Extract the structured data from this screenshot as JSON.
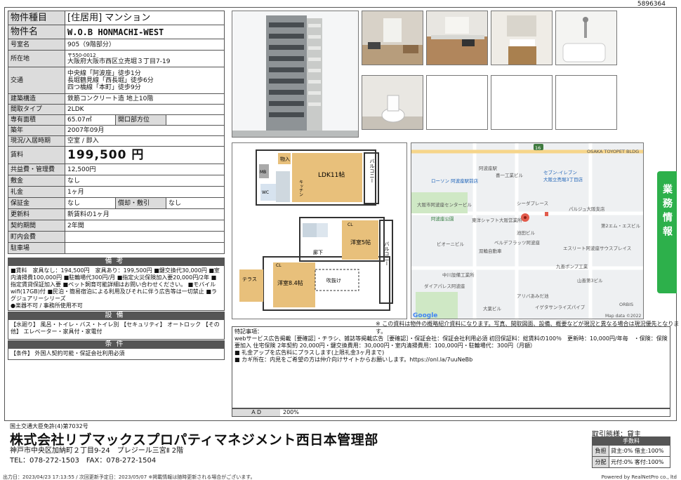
{
  "doc_id": "5896364",
  "property": {
    "rows": [
      {
        "label": "物件種目",
        "value": "[住居用] マンション"
      },
      {
        "label": "物件名",
        "value": "W.O.B HONMACHI-WEST"
      },
      {
        "label": "号室名",
        "value": "905（9階部分）"
      },
      {
        "label": "所在地",
        "postal": "〒550-0012",
        "value": "大阪府大阪市西区立売堀３丁目7-19"
      },
      {
        "label": "交通",
        "lines": [
          "中央線「阿波座」徒歩1分",
          "長堀鶴見線「西長堀」徒歩6分",
          "四つ橋線「本町」徒歩9分"
        ]
      },
      {
        "label": "建築構造",
        "value": "鉄筋コンクリート造 地上10階"
      },
      {
        "label": "間取タイプ",
        "value": "2LDK"
      },
      {
        "label": "専有面積",
        "value": "65.07㎡",
        "label2": "開口部方位",
        "value2": ""
      },
      {
        "label": "築年",
        "value": "2007年09月"
      },
      {
        "label": "現況/入居時期",
        "value": "空室 / 即入"
      },
      {
        "label": "賃料",
        "value": "199,500 円"
      },
      {
        "label": "共益費・管理費",
        "value": "12,500円"
      },
      {
        "label": "敷金",
        "value": "なし"
      },
      {
        "label": "礼金",
        "value": "1ヶ月"
      },
      {
        "label": "保証金",
        "value": "なし",
        "label2": "償却・敷引",
        "value2": "なし"
      },
      {
        "label": "更新料",
        "value": "新賃料の1ヶ月"
      },
      {
        "label": "契約期間",
        "value": "2年間"
      },
      {
        "label": "町内会費",
        "value": ""
      },
      {
        "label": "駐車場",
        "value": ""
      }
    ]
  },
  "remarks": {
    "title": "備考",
    "text": "■賃料　家具なし：194,500円　家具あり：199,500円 ■鍵交換代30,000円 ■室内清掃費100,000円 ■駐輪場代300円/月 ■指定火災保険加入要20,000円/2年 ■指定賃貸保証加入要 ■ペット飼育可能詳細はお問い合わせください。 ■モバイルwifi(17GB)付 ■民泊・簡易宿泊による利用及びそれに伴う広告等は一切禁止 ■ラグジュアリーシリーズ",
    "text2": "●楽器不可 / 事務所使用不可"
  },
  "equipment": {
    "title": "設備",
    "text": "【水廻り】 風呂・トイレ・バス・トイレ別 【セキュリティ】 オートロック 【その他】 エレベーター・家具付・家電付"
  },
  "conditions": {
    "title": "条件",
    "text": "【条件】 外国人契約可能・保証会社利用必須"
  },
  "floorplan": {
    "labels": {
      "ldk": "LDK11帖",
      "bal1": "バルコニー",
      "bal2": "バルコニー",
      "western1": "洋室5帖",
      "western2": "洋室8.4帖",
      "terrace": "テラス",
      "hall": "廊下",
      "void": "吹抜け",
      "storage": "物入",
      "cl1": "CL",
      "cl2": "CL",
      "mb": "MB",
      "wc": "WC",
      "kitchen": "キッチン"
    }
  },
  "map": {
    "labels": [
      "阿波座駅",
      "喜一工業ビル",
      "ローソン 阿波座駅前店",
      "セブン-イレブン",
      "大阪立売堀3丁目店",
      "OSAKA TOYOPET BLDG",
      "大阪市阿波座センタービル",
      "シーダプレース",
      "パルジュ大阪支店",
      "阿波座公園",
      "東洋シャフト大阪営業所",
      "池田ビル",
      "第2エム・エスビル",
      "ベルデフラッツ阿波座",
      "ビオーニビル",
      "双輪自動車",
      "エスリート阿波座サウスプレイス",
      "中川設備工業所",
      "九善ポンプ工業",
      "山善第3ビル",
      "ダイアパレス阿波座",
      "アリバあみだ池",
      "イゲタサンライズパイプ",
      "大薬ビル",
      "ORBIS",
      "Google",
      "Map data ©2022"
    ],
    "route_number": "16"
  },
  "image_note": "※ この資料は物件の概略紹介資料になります。写真、間取図面、設備、概要などが現況と異なる場合は現況優先となります。",
  "notes": {
    "title": "特記事項：",
    "lines": [
      "webサービス広告掲載［要確認］・チラシ、雑誌等掲載広告［要確認］・保証会社：保証会社利用必須 初回保証料：総賃料の100％　更新時：10,000円/年毎　・保険：保険要加入 住宅保険 2年契約 20,000円・鍵交換費用：30,000円・室内清掃費用：100,000円・駐輪場代：300円（月額）",
      "■ 礼金アップを広告料にプラスします(上限礼金3ヶ月まで)",
      "■ カギ所在：内見をご希望の方は仲介向けサイトからお願いします。https://onl.la/7uuNeBb"
    ]
  },
  "ad": {
    "label": "ＡＤ",
    "value": "200%"
  },
  "side_tab": "業務情報",
  "company": {
    "license": "国土交通大臣免許(4)第7032号",
    "name": "株式会社リブマックスプロパティマネジメント西日本管理部",
    "address": "神戸市中央区加納町２丁目9-24　プレジール三宮Ⅱ 2階",
    "tel": "TEL：078-272-1503　FAX：078-272-1504"
  },
  "deal": {
    "label": "取引態様：貸主",
    "fee_title": "手数料",
    "rows": [
      {
        "label": "負担",
        "value": "貸主:0% 借主:100%"
      },
      {
        "label": "分配",
        "value": "元付:0% 客付:100%"
      }
    ]
  },
  "footer": {
    "left": "出力日：2023/04/23 17:13:55 / 次回更新予定日：2023/05/07 ※掲載情報は随時更新される場合がございます。",
    "right": "Powered by RealNetPro co., ltd"
  }
}
